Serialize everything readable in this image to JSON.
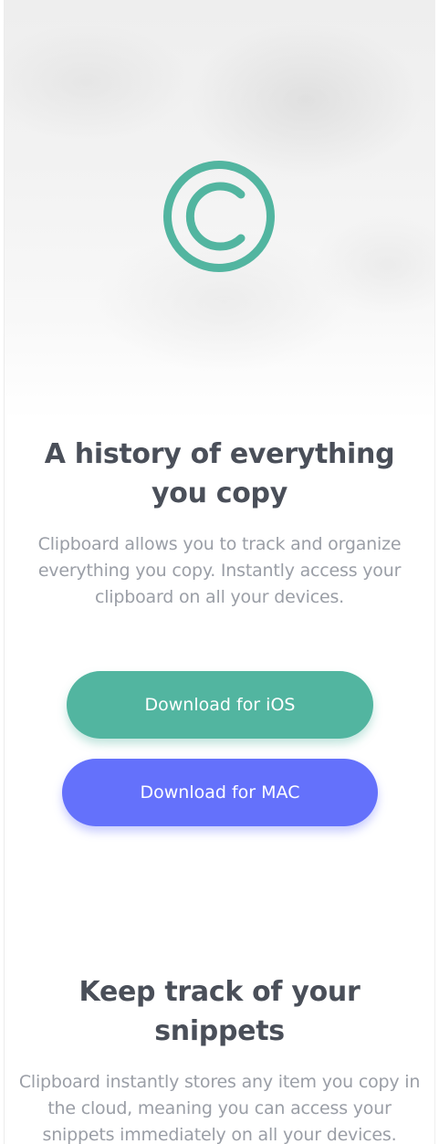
{
  "hero": {
    "logo_icon": "copyright-circle-icon",
    "accent_color": "#52b5a0",
    "headline": "A history of everything you copy",
    "description": "Clipboard allows you to track and organize everything you copy. Instantly access your clipboard on all your devices."
  },
  "cta": {
    "ios_label": "Download for iOS",
    "mac_label": "Download for MAC",
    "ios_color": "#52b5a0",
    "mac_color": "#6471fb"
  },
  "snippets": {
    "headline": "Keep track of your snippets",
    "description": "Clipboard instantly stores any item you copy in the cloud, meaning you can access your snippets immediately on all your devices."
  }
}
